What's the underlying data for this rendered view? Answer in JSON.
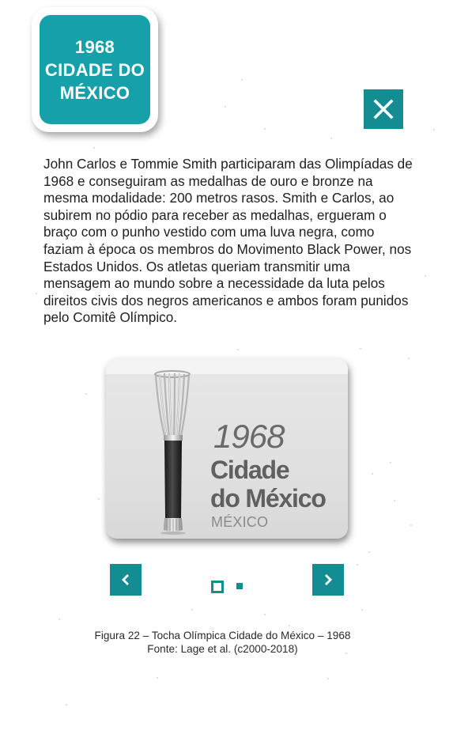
{
  "title_card": {
    "lines": [
      "1968",
      "CIDADE DO",
      "MÉXICO"
    ]
  },
  "close_button": {
    "icon": "close-icon",
    "label": "×"
  },
  "body": {
    "paragraph": "John Carlos e Tommie Smith participaram das Olimpíadas de 1968 e conseguiram as medalhas de ouro e bronze na mesma modalidade: 200 metros rasos. Smith e Carlos, ao subirem no pódio para receber as medalhas, ergueram o braço com o punho vestido com uma luva negra, como faziam à época os membros do Movimento Black Power, nos Estados Unidos. Os atletas queriam transmitir uma mensagem ao mundo sobre a necessidade da luta pelos direitos civis dos negros americanos e ambos foram punidos pelo Comitê Olímpico."
  },
  "figure": {
    "year": "1968",
    "city_line1": "Cidade",
    "city_line2": "do México",
    "country": "MÉXICO"
  },
  "carousel": {
    "prev_icon": "chevron-left-icon",
    "next_icon": "chevron-right-icon",
    "current": 1,
    "total": 2
  },
  "caption": {
    "line1": "Figura 22 – Tocha Olímpica Cidade do México – 1968",
    "line2": "Fonte: Lage et al. (c2000-2018)"
  },
  "colors": {
    "accent": "#16a0a9",
    "accent_dark": "#138d91",
    "text": "#1f1f1f"
  }
}
